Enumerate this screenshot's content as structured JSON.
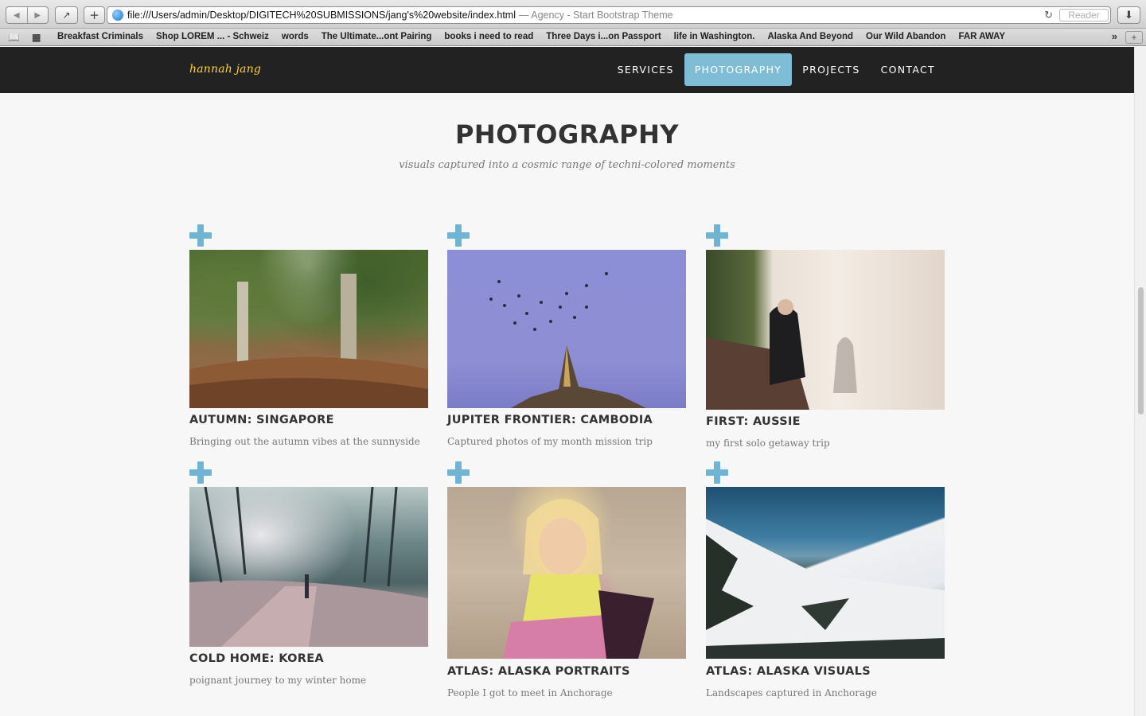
{
  "browser": {
    "url": "file:///Users/admin/Desktop/DIGITECH%20SUBMISSIONS/jang's%20website/index.html",
    "page_title": "— Agency - Start Bootstrap Theme",
    "reader_label": "Reader",
    "bookmarks": [
      "Breakfast Criminals",
      "Shop LOREM ... - Schweiz",
      "words",
      "The Ultimate...ont Pairing",
      "books i need to read",
      "Three Days i...on Passport",
      "life in Washington.",
      "Alaska And Beyond",
      "Our Wild Abandon",
      "FAR AWAY"
    ]
  },
  "site": {
    "brand": "hannah jang",
    "nav": [
      {
        "label": "SERVICES",
        "active": false
      },
      {
        "label": "PHOTOGRAPHY",
        "active": true
      },
      {
        "label": "PROJECTS",
        "active": false
      },
      {
        "label": "CONTACT",
        "active": false
      }
    ],
    "section": {
      "heading": "PHOTOGRAPHY",
      "subheading": "visuals captured into a cosmic range of techni-colored moments"
    },
    "portfolio": [
      {
        "title": "AUTUMN: SINGAPORE",
        "description": "Bringing out the autumn vibes at the sunnyside"
      },
      {
        "title": "JUPITER FRONTIER: CAMBODIA",
        "description": "Captured photos of my month mission trip"
      },
      {
        "title": "FIRST: AUSSIE",
        "description": "my first solo getaway trip"
      },
      {
        "title": "COLD HOME: KOREA",
        "description": "poignant journey to my winter home"
      },
      {
        "title": "ATLAS: ALASKA PORTRAITS",
        "description": "People I got to meet in Anchorage"
      },
      {
        "title": "ATLAS: ALASKA VISUALS",
        "description": "Landscapes captured in Anchorage"
      }
    ]
  }
}
